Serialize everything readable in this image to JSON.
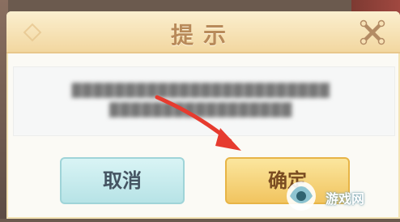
{
  "dialog": {
    "title": "提示",
    "message_line_1": "▓▓▓▓▓▓▓▓▓▓▓▓▓▓▓▓▓▓▓▓▓▓▓▓",
    "message_line_2": "▓▓▓▓▓▓▓▓▓▓▓▓▓▓▓▓▓"
  },
  "buttons": {
    "cancel_label": "取消",
    "confirm_label": "确定"
  },
  "watermark": {
    "text": "游戏网"
  },
  "colors": {
    "header": "#f2d7a0",
    "cancel_button": "#b7e3e6",
    "confirm_button": "#f1c45f",
    "arrow": "#e63b2f"
  }
}
